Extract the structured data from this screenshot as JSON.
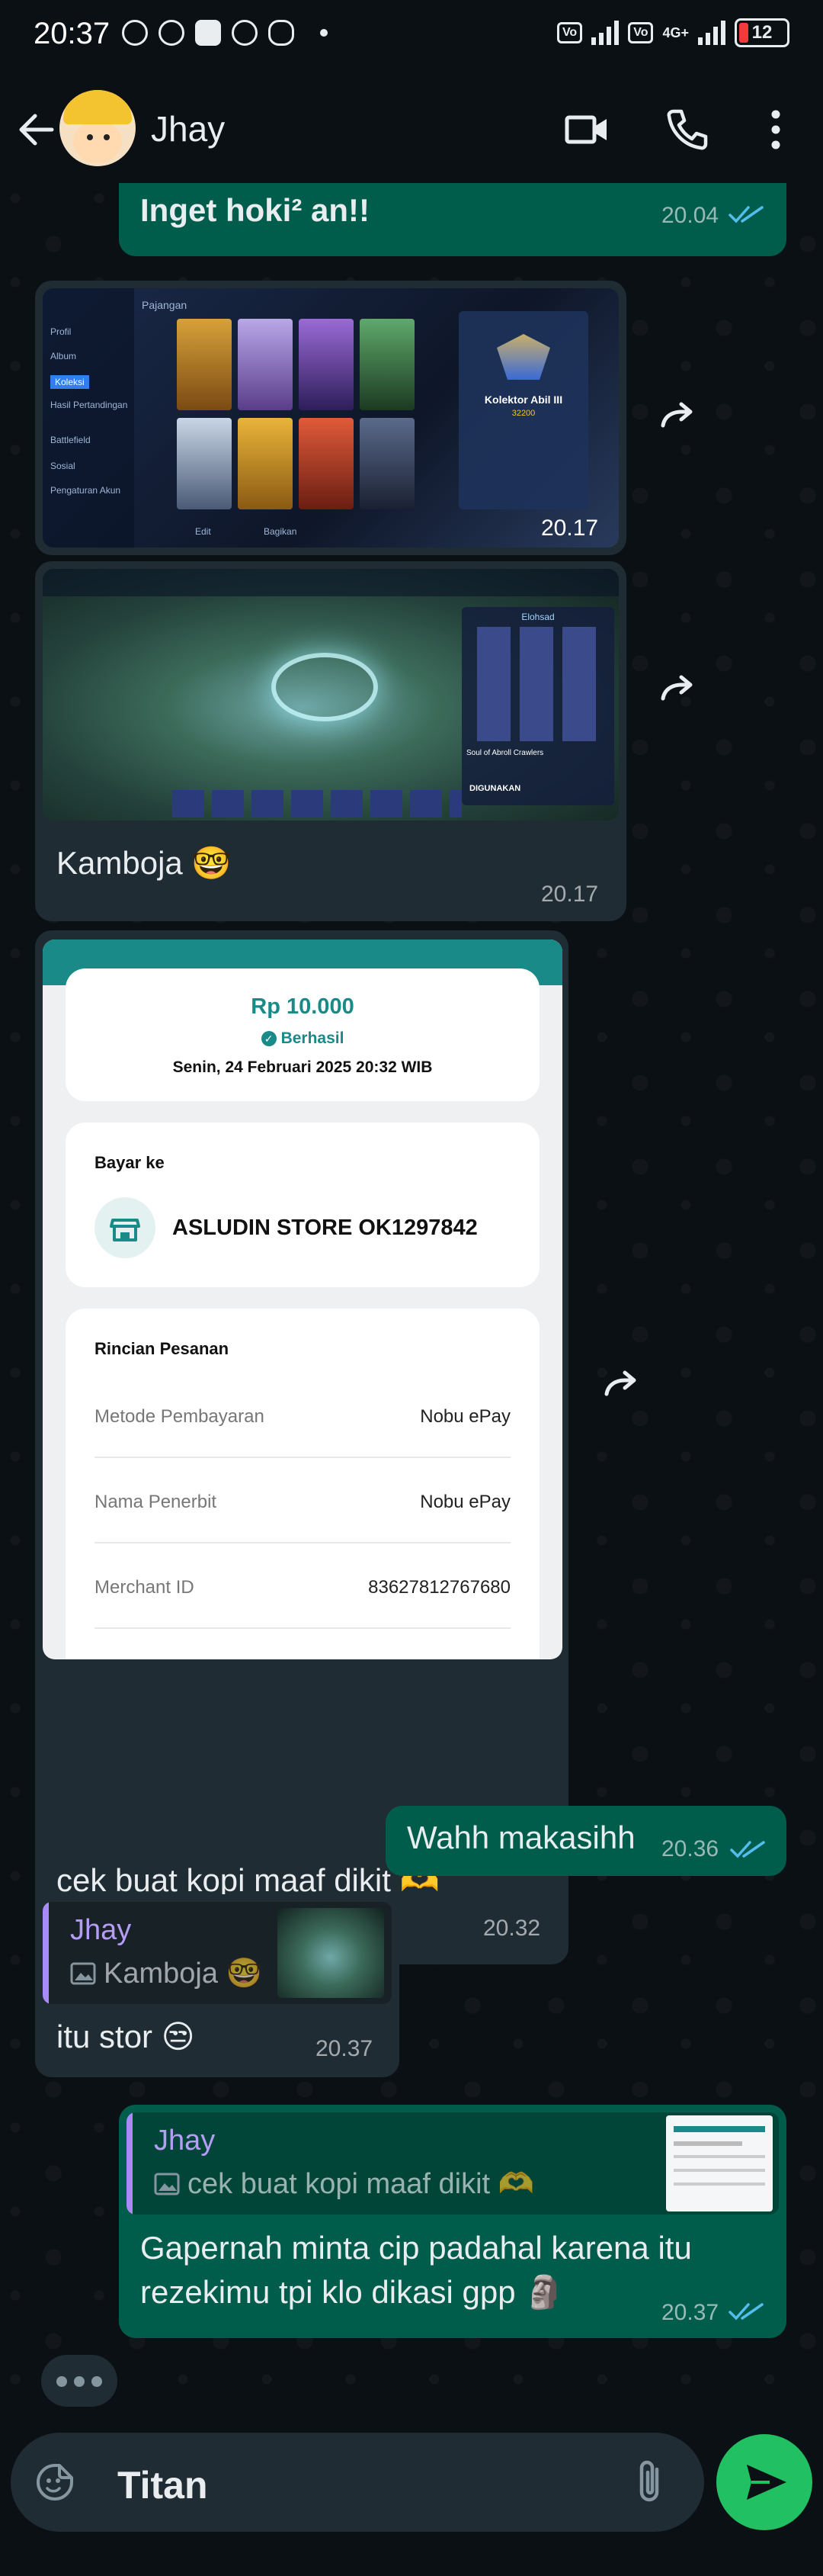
{
  "status_bar": {
    "time": "20:37",
    "network": "4G+",
    "battery": "12"
  },
  "header": {
    "contact_name": "Jhay"
  },
  "messages": {
    "m1": {
      "text": "Inget hoki² an!!",
      "time": "20.04"
    },
    "m2": {
      "time": "20.17",
      "screenshot": {
        "title": "Pajangan",
        "menu": [
          "Profil",
          "Album",
          "Koleksi",
          "Hasil Pertandingan",
          "Battlefield",
          "Sosial",
          "Pengaturan Akun"
        ],
        "panel_title": "Kolektor Abil III",
        "panel_points": "32200",
        "buttons": [
          "Edit",
          "Bagikan"
        ]
      }
    },
    "m3": {
      "time": "20.17",
      "caption": "Kamboja 🤓",
      "screenshot": {
        "panel_title": "Elohsad",
        "panel_subtitle": "Soul of Abroll Crawlers",
        "button": "DIGUNAKAN"
      }
    },
    "m4": {
      "time": "20.32",
      "caption": "cek buat kopi maaf dikit 🫶",
      "receipt": {
        "amount": "Rp 10.000",
        "status": "Berhasil",
        "date": "Senin, 24 Februari 2025 20:32 WIB",
        "pay_to_label": "Bayar ke",
        "store": "ASLUDIN STORE OK1297842",
        "details_label": "Rincian Pesanan",
        "rows": [
          {
            "label": "Metode Pembayaran",
            "value": "Nobu ePay"
          },
          {
            "label": "Nama Penerbit",
            "value": "Nobu ePay"
          },
          {
            "label": "Merchant ID",
            "value": "83627812767680"
          }
        ]
      }
    },
    "m5": {
      "text": "Wahh makasihh",
      "time": "20.36"
    },
    "m6": {
      "reply_name": "Jhay",
      "reply_text": "Kamboja 🤓",
      "text": "itu stor 😒",
      "time": "20.37"
    },
    "m7": {
      "reply_name": "Jhay",
      "reply_text": "cek buat kopi maaf dikit 🫶",
      "text_line1": "Gapernah minta cip padahal karena itu",
      "text_line2": "rezekimu tpi klo dikasi gpp 🗿",
      "time": "20.37"
    }
  },
  "composer": {
    "text": "Titan"
  },
  "colors": {
    "outgoing": "#005c4b",
    "incoming": "#202c33",
    "accent": "#21c063",
    "read_ticks": "#53bdeb"
  }
}
